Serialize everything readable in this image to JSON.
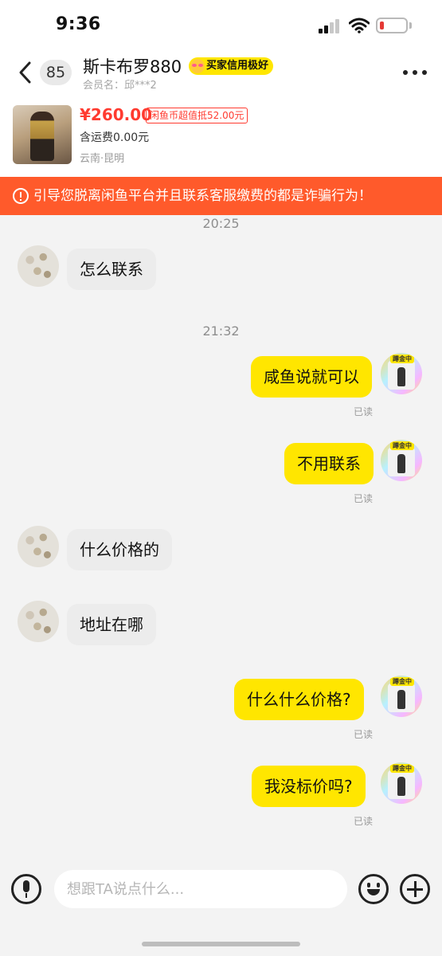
{
  "status_bar": {
    "time": "9:36"
  },
  "header": {
    "unread_count": "85",
    "seller_name": "斯卡布罗880",
    "credit_badge": "买家信用极好",
    "member_label": "会员名：",
    "member_name": "邱***2"
  },
  "product": {
    "price": "¥260.00",
    "coin_tag": "闲鱼币超值抵52.00元",
    "shipping": "含运费0.00元",
    "location": "云南·昆明"
  },
  "warning": {
    "text": "引导您脱离闲鱼平台并且联系客服缴费的都是诈骗行为！",
    "color": "#ff5a2b"
  },
  "chat": {
    "timestamps": [
      "20:25",
      "21:32"
    ],
    "messages": [
      {
        "side": "left",
        "text": "怎么联系"
      },
      {
        "side": "right",
        "text": "咸鱼说就可以",
        "status": "已读"
      },
      {
        "side": "right",
        "text": "不用联系",
        "status": "已读"
      },
      {
        "side": "left",
        "text": "什么价格的"
      },
      {
        "side": "left",
        "text": "地址在哪"
      },
      {
        "side": "right",
        "text": "什么什么价格?",
        "status": "已读"
      },
      {
        "side": "right",
        "text": "我没标价吗?",
        "status": "已读"
      }
    ],
    "avatar_status": "蹲金中",
    "bubble_color_self": "#ffe600",
    "bubble_color_other": "#ececec"
  },
  "input_bar": {
    "placeholder": "想跟TA说点什么...",
    "value": ""
  }
}
